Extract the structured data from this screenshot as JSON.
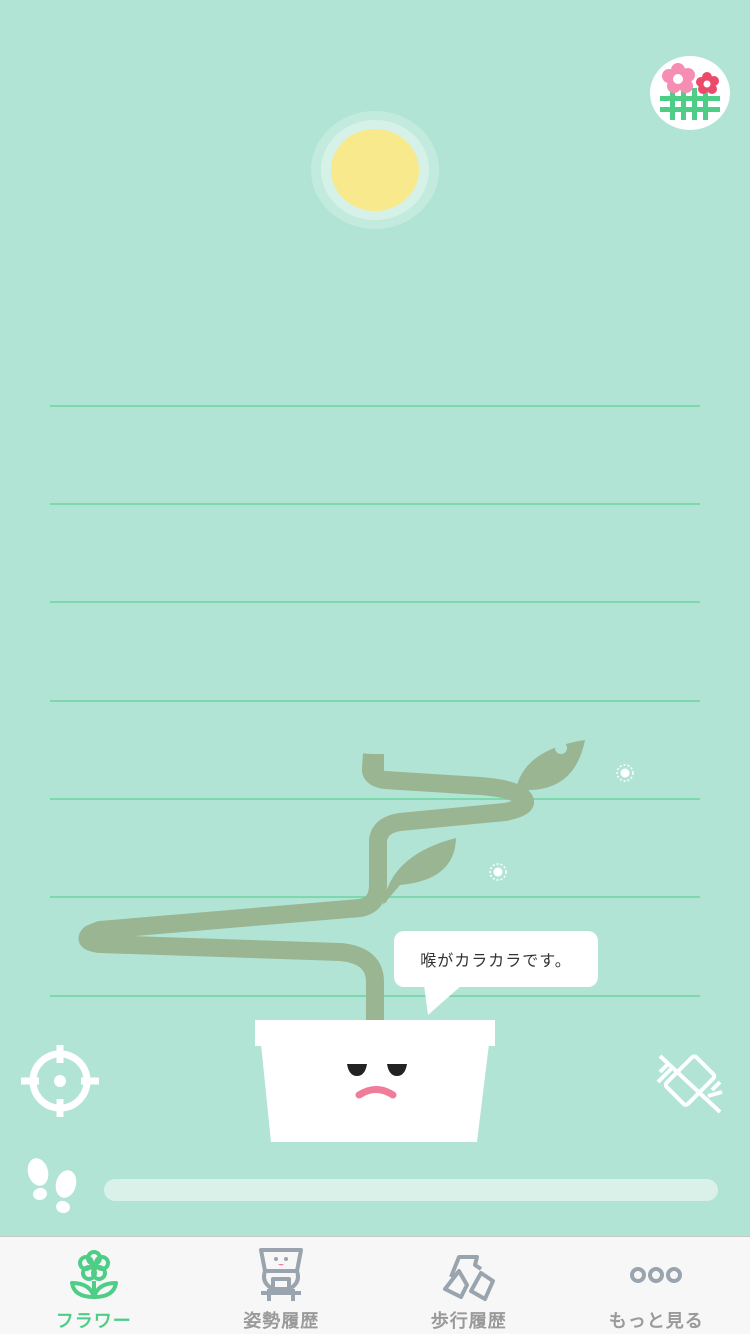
{
  "speech_bubble": {
    "text": "喉がカラカラです。"
  },
  "steps": {
    "progress": 0
  },
  "tabs": [
    {
      "label": "フラワー",
      "icon": "flower-icon",
      "active": true
    },
    {
      "label": "姿勢履歴",
      "icon": "posture-icon",
      "active": false
    },
    {
      "label": "歩行履歴",
      "icon": "walking-icon",
      "active": false
    },
    {
      "label": "もっと見る",
      "icon": "more-icon",
      "active": false
    }
  ],
  "icons": {
    "garden": "flower-garden-icon",
    "sun": "sun-icon",
    "locate": "crosshair-icon",
    "vibration_off": "vibration-off-icon",
    "steps": "footprints-icon"
  },
  "colors": {
    "background": "#b1e4d5",
    "rule_line": "#7dd8ae",
    "stem": "#9ab592",
    "accent_green": "#4ecd87",
    "inactive_tab": "#9a9a9a",
    "sun": "#f8e98c",
    "mouth": "#f07c9b"
  }
}
